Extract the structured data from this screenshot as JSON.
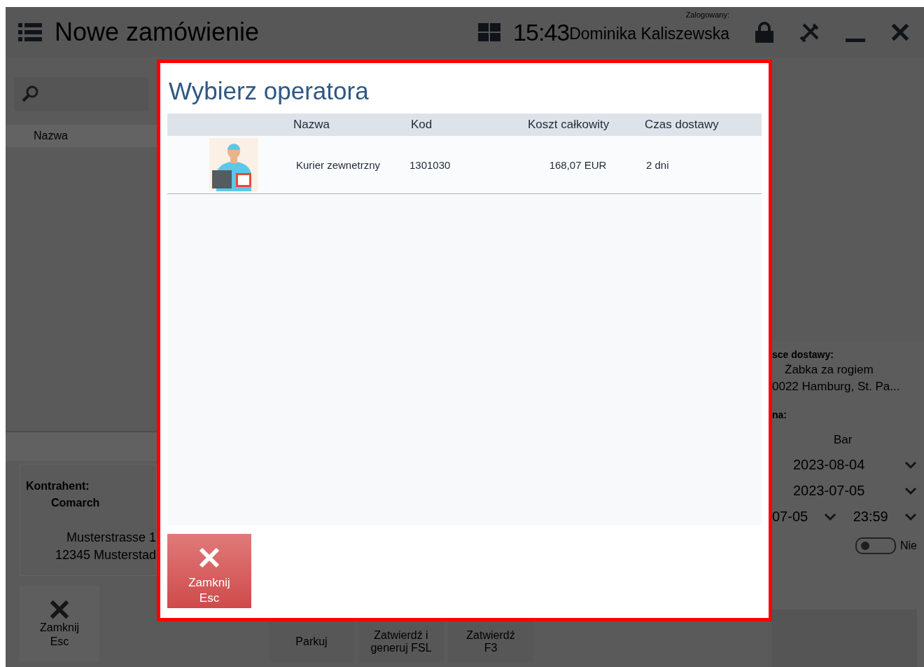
{
  "header": {
    "title": "Nowe zamówienie",
    "time": "15:43",
    "logged_label": "Zalogowany:",
    "user": "Dominika Kaliszewska"
  },
  "left_panel": {
    "column_header": "Nazwa",
    "contractor": {
      "label": "Kontrahent:",
      "name": "Comarch",
      "address_lines": [
        "Musterstrasse 1",
        "12345 Musterstad"
      ]
    },
    "close_button": {
      "label": "Zamknij",
      "shortcut": "Esc"
    }
  },
  "footer_buttons": [
    {
      "lines": [
        "Parkuj"
      ]
    },
    {
      "lines": [
        "Zatwierdź i",
        "generuj FSL"
      ]
    },
    {
      "lines": [
        "Zatwierdź",
        "F3"
      ]
    }
  ],
  "right_panel": {
    "delivery_label": "sce dostawy:",
    "delivery_lines": [
      "Żabka za rogiem",
      "0022 Hamburg, St. Pa..."
    ],
    "field_label": "na:",
    "field_value": "Bar",
    "dates": [
      "2023-08-04",
      "2023-07-05"
    ],
    "date_time": {
      "date": "07-05",
      "time": "23:59"
    },
    "toggle": {
      "on": false,
      "label": "Nie"
    }
  },
  "dialog": {
    "title": "Wybierz operatora",
    "columns": [
      "Nazwa",
      "Kod",
      "Koszt całkowity",
      "Czas dostawy"
    ],
    "rows": [
      {
        "name": "Kurier zewnetrzny",
        "code": "1301030",
        "cost": "168,07 EUR",
        "delivery_time": "2 dni"
      }
    ],
    "close_button": {
      "label": "Zamknij",
      "shortcut": "Esc"
    }
  }
}
